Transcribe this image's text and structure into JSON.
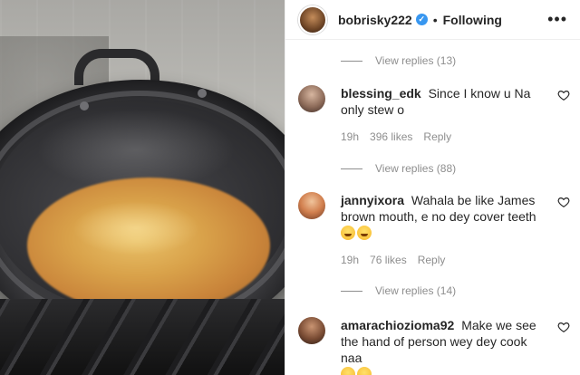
{
  "post": {
    "username": "bobrisky222",
    "separator": "•",
    "follow_state": "Following",
    "more_label": "•••"
  },
  "threads": [
    {
      "view_replies": "View replies (13)"
    },
    {
      "comment": {
        "username": "blessing_edk",
        "text": "Since I know u Na only stew o",
        "time": "19h",
        "likes": "396 likes",
        "reply_label": "Reply"
      },
      "view_replies": "View replies (88)"
    },
    {
      "comment": {
        "username": "jannyixora",
        "text": "Wahala be like James brown mouth, e no dey cover teeth",
        "emoji": [
          "grinning-sweat-emoji",
          "grinning-sweat-emoji"
        ],
        "time": "19h",
        "likes": "76 likes",
        "reply_label": "Reply"
      },
      "view_replies": "View replies (14)"
    },
    {
      "comment": {
        "username": "amarachiozioma92",
        "text": "Make we see the hand of person wey dey cook naa",
        "emoji": [
          "grinning-sweat-emoji",
          "grinning-sweat-emoji"
        ]
      }
    }
  ],
  "colors": {
    "link": "#8e8e8e",
    "verified": "#3897f0",
    "text": "#262626"
  }
}
